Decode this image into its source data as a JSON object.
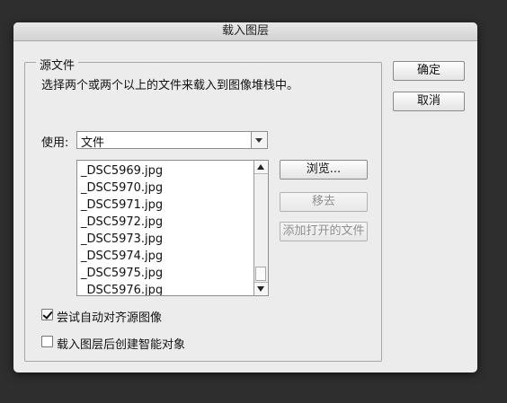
{
  "dialog": {
    "title": "载入图层",
    "ok_label": "确定",
    "cancel_label": "取消"
  },
  "source": {
    "legend": "源文件",
    "description": "选择两个或两个以上的文件来载入到图像堆栈中。",
    "use_label": "使用:",
    "use_value": "文件",
    "files": [
      "_DSC5969.jpg",
      "_DSC5970.jpg",
      "_DSC5971.jpg",
      "_DSC5972.jpg",
      "_DSC5973.jpg",
      "_DSC5974.jpg",
      "_DSC5975.jpg",
      "_DSC5976.jpg"
    ],
    "browse_label": "浏览...",
    "remove_label": "移去",
    "add_open_label": "添加打开的文件"
  },
  "options": {
    "auto_align_label": "尝试自动对齐源图像",
    "auto_align_checked": true,
    "smart_object_label": "载入图层后创建智能对象",
    "smart_object_checked": false
  }
}
